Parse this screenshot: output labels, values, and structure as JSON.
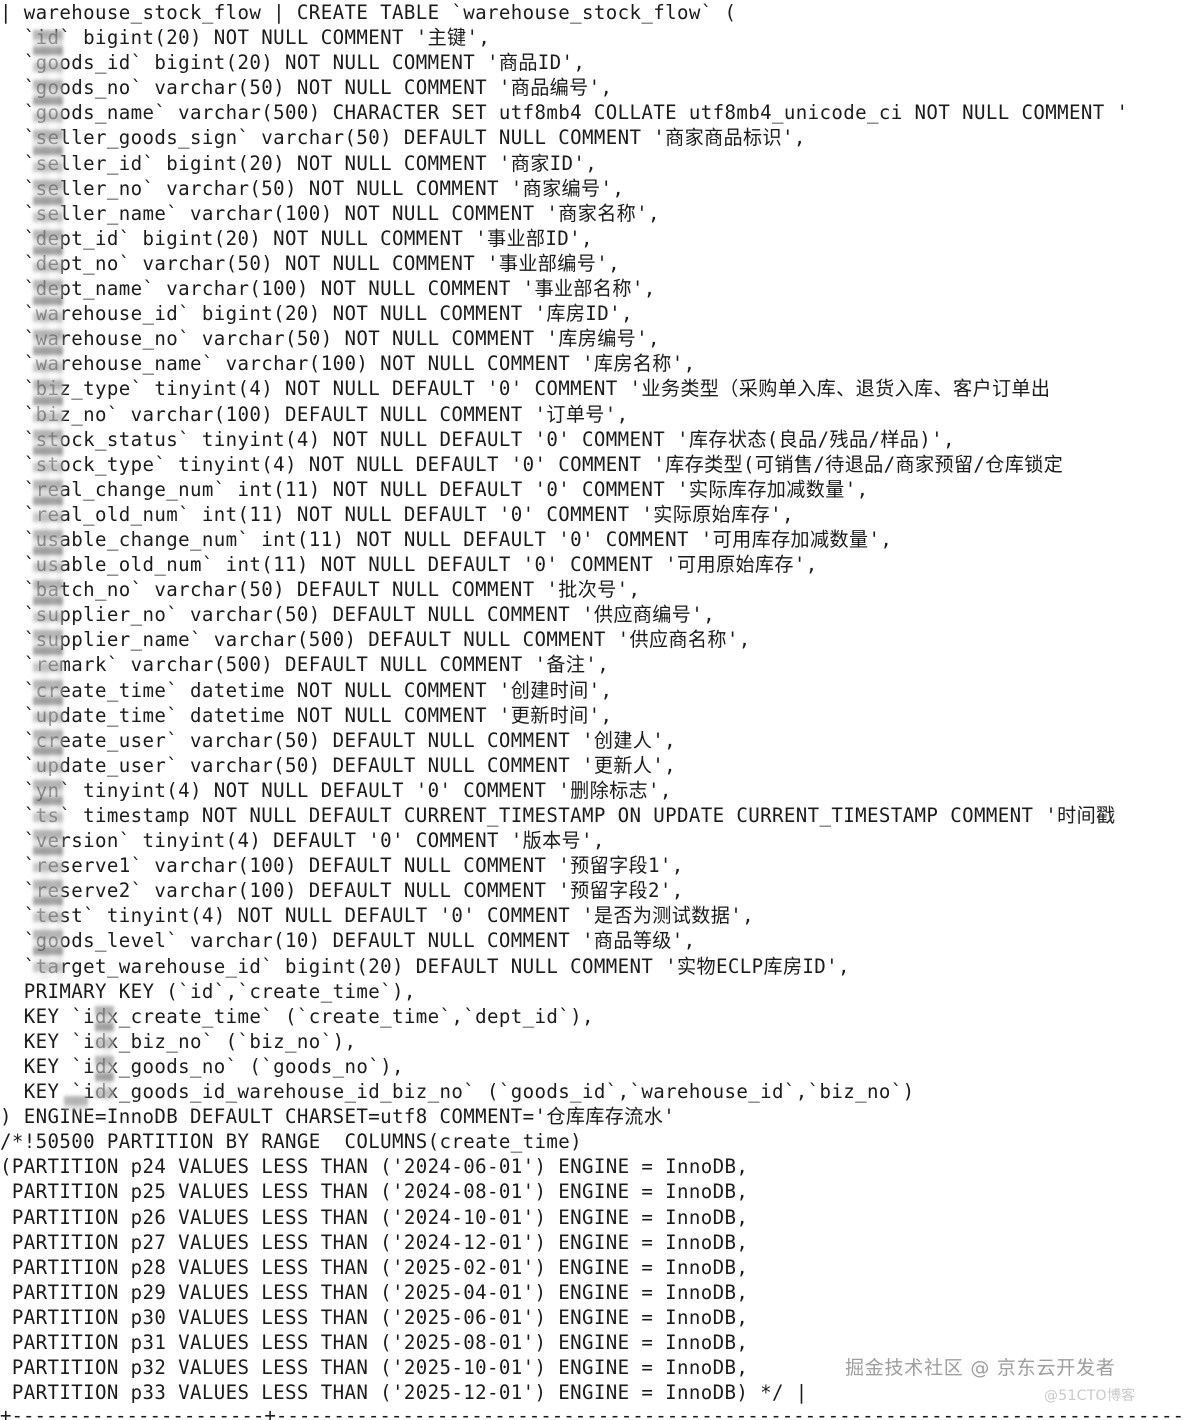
{
  "terminal": {
    "app": "mysql-cli",
    "prompt_symbol": "|",
    "colors": {
      "background": "#ffffff",
      "text": "#1b1b1b",
      "watermark_primary": "#9e9e9e",
      "watermark_secondary": "#c9c9c9"
    }
  },
  "result": {
    "table_name": "warehouse_stock_flow",
    "statement_header": "| warehouse_stock_flow | CREATE TABLE `warehouse_stock_flow` (",
    "bottom_border": "+----------------------+------------------------------------------------------------------------------------------"
  },
  "ddl": {
    "lines": [
      "| warehouse_stock_flow | CREATE TABLE `warehouse_stock_flow` (",
      "  `id` bigint(20) NOT NULL COMMENT '主键',",
      "  `goods_id` bigint(20) NOT NULL COMMENT '商品ID',",
      "  `goods_no` varchar(50) NOT NULL COMMENT '商品编号',",
      "  `goods_name` varchar(500) CHARACTER SET utf8mb4 COLLATE utf8mb4_unicode_ci NOT NULL COMMENT '",
      "  `seller_goods_sign` varchar(50) DEFAULT NULL COMMENT '商家商品标识',",
      "  `seller_id` bigint(20) NOT NULL COMMENT '商家ID',",
      "  `seller_no` varchar(50) NOT NULL COMMENT '商家编号',",
      "  `seller_name` varchar(100) NOT NULL COMMENT '商家名称',",
      "  `dept_id` bigint(20) NOT NULL COMMENT '事业部ID',",
      "  `dept_no` varchar(50) NOT NULL COMMENT '事业部编号',",
      "  `dept_name` varchar(100) NOT NULL COMMENT '事业部名称',",
      "  `warehouse_id` bigint(20) NOT NULL COMMENT '库房ID',",
      "  `warehouse_no` varchar(50) NOT NULL COMMENT '库房编号',",
      "  `warehouse_name` varchar(100) NOT NULL COMMENT '库房名称',",
      "  `biz_type` tinyint(4) NOT NULL DEFAULT '0' COMMENT '业务类型（采购单入库、退货入库、客户订单出",
      "  `biz_no` varchar(100) DEFAULT NULL COMMENT '订单号',",
      "  `stock_status` tinyint(4) NOT NULL DEFAULT '0' COMMENT '库存状态(良品/残品/样品)',",
      "  `stock_type` tinyint(4) NOT NULL DEFAULT '0' COMMENT '库存类型(可销售/待退品/商家预留/仓库锁定",
      "  `real_change_num` int(11) NOT NULL DEFAULT '0' COMMENT '实际库存加减数量',",
      "  `real_old_num` int(11) NOT NULL DEFAULT '0' COMMENT '实际原始库存',",
      "  `usable_change_num` int(11) NOT NULL DEFAULT '0' COMMENT '可用库存加减数量',",
      "  `usable_old_num` int(11) NOT NULL DEFAULT '0' COMMENT '可用原始库存',",
      "  `batch_no` varchar(50) DEFAULT NULL COMMENT '批次号',",
      "  `supplier_no` varchar(50) DEFAULT NULL COMMENT '供应商编号',",
      "  `supplier_name` varchar(500) DEFAULT NULL COMMENT '供应商名称',",
      "  `remark` varchar(500) DEFAULT NULL COMMENT '备注',",
      "  `create_time` datetime NOT NULL COMMENT '创建时间',",
      "  `update_time` datetime NOT NULL COMMENT '更新时间',",
      "  `create_user` varchar(50) DEFAULT NULL COMMENT '创建人',",
      "  `update_user` varchar(50) DEFAULT NULL COMMENT '更新人',",
      "  `yn` tinyint(4) NOT NULL DEFAULT '0' COMMENT '删除标志',",
      "  `ts` timestamp NOT NULL DEFAULT CURRENT_TIMESTAMP ON UPDATE CURRENT_TIMESTAMP COMMENT '时间戳",
      "  `version` tinyint(4) DEFAULT '0' COMMENT '版本号',",
      "  `reserve1` varchar(100) DEFAULT NULL COMMENT '预留字段1',",
      "  `reserve2` varchar(100) DEFAULT NULL COMMENT '预留字段2',",
      "  `test` tinyint(4) NOT NULL DEFAULT '0' COMMENT '是否为测试数据',",
      "  `goods_level` varchar(10) DEFAULT NULL COMMENT '商品等级',",
      "  `target_warehouse_id` bigint(20) DEFAULT NULL COMMENT '实物ECLP库房ID',",
      "  PRIMARY KEY (`id`,`create_time`),",
      "  KEY `idx_create_time` (`create_time`,`dept_id`),",
      "  KEY `idx_biz_no` (`biz_no`),",
      "  KEY `idx_goods_no` (`goods_no`),",
      "  KEY `idx_goods_id_warehouse_id_biz_no` (`goods_id`,`warehouse_id`,`biz_no`)",
      ") ENGINE=InnoDB DEFAULT CHARSET=utf8 COMMENT='仓库库存流水'",
      "/*!50500 PARTITION BY RANGE  COLUMNS(create_time)",
      "(PARTITION p24 VALUES LESS THAN ('2024-06-01') ENGINE = InnoDB,",
      " PARTITION p25 VALUES LESS THAN ('2024-08-01') ENGINE = InnoDB,",
      " PARTITION p26 VALUES LESS THAN ('2024-10-01') ENGINE = InnoDB,",
      " PARTITION p27 VALUES LESS THAN ('2024-12-01') ENGINE = InnoDB,",
      " PARTITION p28 VALUES LESS THAN ('2025-02-01') ENGINE = InnoDB,",
      " PARTITION p29 VALUES LESS THAN ('2025-04-01') ENGINE = InnoDB,",
      " PARTITION p30 VALUES LESS THAN ('2025-06-01') ENGINE = InnoDB,",
      " PARTITION p31 VALUES LESS THAN ('2025-08-01') ENGINE = InnoDB,",
      " PARTITION p32 VALUES LESS THAN ('2025-10-01') ENGINE = InnoDB,",
      " PARTITION p33 VALUES LESS THAN ('2025-12-01') ENGINE = InnoDB) */ |"
    ]
  },
  "columns": [
    {
      "name": "id",
      "type": "bigint(20)",
      "nullability": "NOT NULL",
      "comment": "主键"
    },
    {
      "name": "goods_id",
      "type": "bigint(20)",
      "nullability": "NOT NULL",
      "comment": "商品ID"
    },
    {
      "name": "goods_no",
      "type": "varchar(50)",
      "nullability": "NOT NULL",
      "comment": "商品编号"
    },
    {
      "name": "goods_name",
      "type": "varchar(500)",
      "charset": "utf8mb4",
      "collate": "utf8mb4_unicode_ci",
      "nullability": "NOT NULL",
      "comment": ""
    },
    {
      "name": "seller_goods_sign",
      "type": "varchar(50)",
      "nullability": "DEFAULT NULL",
      "comment": "商家商品标识"
    },
    {
      "name": "seller_id",
      "type": "bigint(20)",
      "nullability": "NOT NULL",
      "comment": "商家ID"
    },
    {
      "name": "seller_no",
      "type": "varchar(50)",
      "nullability": "NOT NULL",
      "comment": "商家编号"
    },
    {
      "name": "seller_name",
      "type": "varchar(100)",
      "nullability": "NOT NULL",
      "comment": "商家名称"
    },
    {
      "name": "dept_id",
      "type": "bigint(20)",
      "nullability": "NOT NULL",
      "comment": "事业部ID"
    },
    {
      "name": "dept_no",
      "type": "varchar(50)",
      "nullability": "NOT NULL",
      "comment": "事业部编号"
    },
    {
      "name": "dept_name",
      "type": "varchar(100)",
      "nullability": "NOT NULL",
      "comment": "事业部名称"
    },
    {
      "name": "warehouse_id",
      "type": "bigint(20)",
      "nullability": "NOT NULL",
      "comment": "库房ID"
    },
    {
      "name": "warehouse_no",
      "type": "varchar(50)",
      "nullability": "NOT NULL",
      "comment": "库房编号"
    },
    {
      "name": "warehouse_name",
      "type": "varchar(100)",
      "nullability": "NOT NULL",
      "comment": "库房名称"
    },
    {
      "name": "biz_type",
      "type": "tinyint(4)",
      "nullability": "NOT NULL",
      "default": "0",
      "comment": "业务类型（采购单入库、退货入库、客户订单出"
    },
    {
      "name": "biz_no",
      "type": "varchar(100)",
      "nullability": "DEFAULT NULL",
      "comment": "订单号"
    },
    {
      "name": "stock_status",
      "type": "tinyint(4)",
      "nullability": "NOT NULL",
      "default": "0",
      "comment": "库存状态(良品/残品/样品)"
    },
    {
      "name": "stock_type",
      "type": "tinyint(4)",
      "nullability": "NOT NULL",
      "default": "0",
      "comment": "库存类型(可销售/待退品/商家预留/仓库锁定"
    },
    {
      "name": "real_change_num",
      "type": "int(11)",
      "nullability": "NOT NULL",
      "default": "0",
      "comment": "实际库存加减数量"
    },
    {
      "name": "real_old_num",
      "type": "int(11)",
      "nullability": "NOT NULL",
      "default": "0",
      "comment": "实际原始库存"
    },
    {
      "name": "usable_change_num",
      "type": "int(11)",
      "nullability": "NOT NULL",
      "default": "0",
      "comment": "可用库存加减数量"
    },
    {
      "name": "usable_old_num",
      "type": "int(11)",
      "nullability": "NOT NULL",
      "default": "0",
      "comment": "可用原始库存"
    },
    {
      "name": "batch_no",
      "type": "varchar(50)",
      "nullability": "DEFAULT NULL",
      "comment": "批次号"
    },
    {
      "name": "supplier_no",
      "type": "varchar(50)",
      "nullability": "DEFAULT NULL",
      "comment": "供应商编号"
    },
    {
      "name": "supplier_name",
      "type": "varchar(500)",
      "nullability": "DEFAULT NULL",
      "comment": "供应商名称"
    },
    {
      "name": "remark",
      "type": "varchar(500)",
      "nullability": "DEFAULT NULL",
      "comment": "备注"
    },
    {
      "name": "create_time",
      "type": "datetime",
      "nullability": "NOT NULL",
      "comment": "创建时间"
    },
    {
      "name": "update_time",
      "type": "datetime",
      "nullability": "NOT NULL",
      "comment": "更新时间"
    },
    {
      "name": "create_user",
      "type": "varchar(50)",
      "nullability": "DEFAULT NULL",
      "comment": "创建人"
    },
    {
      "name": "update_user",
      "type": "varchar(50)",
      "nullability": "DEFAULT NULL",
      "comment": "更新人"
    },
    {
      "name": "yn",
      "type": "tinyint(4)",
      "nullability": "NOT NULL",
      "default": "0",
      "comment": "删除标志"
    },
    {
      "name": "ts",
      "type": "timestamp",
      "nullability": "NOT NULL",
      "default": "CURRENT_TIMESTAMP",
      "on_update": "CURRENT_TIMESTAMP",
      "comment": "时间戳"
    },
    {
      "name": "version",
      "type": "tinyint(4)",
      "default": "0",
      "comment": "版本号"
    },
    {
      "name": "reserve1",
      "type": "varchar(100)",
      "nullability": "DEFAULT NULL",
      "comment": "预留字段1"
    },
    {
      "name": "reserve2",
      "type": "varchar(100)",
      "nullability": "DEFAULT NULL",
      "comment": "预留字段2"
    },
    {
      "name": "test",
      "type": "tinyint(4)",
      "nullability": "NOT NULL",
      "default": "0",
      "comment": "是否为测试数据"
    },
    {
      "name": "goods_level",
      "type": "varchar(10)",
      "nullability": "DEFAULT NULL",
      "comment": "商品等级"
    },
    {
      "name": "target_warehouse_id",
      "type": "bigint(20)",
      "nullability": "DEFAULT NULL",
      "comment": "实物ECLP库房ID"
    }
  ],
  "indexes": [
    {
      "kind": "PRIMARY KEY",
      "name": "",
      "columns": "`id`,`create_time`"
    },
    {
      "kind": "KEY",
      "name": "idx_create_time",
      "columns": "`create_time`,`dept_id`"
    },
    {
      "kind": "KEY",
      "name": "idx_biz_no",
      "columns": "`biz_no`"
    },
    {
      "kind": "KEY",
      "name": "idx_goods_no",
      "columns": "`goods_no`"
    },
    {
      "kind": "KEY",
      "name": "idx_goods_id_warehouse_id_biz_no",
      "columns": "`goods_id`,`warehouse_id`,`biz_no`"
    }
  ],
  "table_options": {
    "engine": "InnoDB",
    "default_charset": "utf8",
    "comment": "仓库库存流水",
    "partition_clause": "/*!50500 PARTITION BY RANGE  COLUMNS(create_time)"
  },
  "partitions": [
    {
      "name": "p24",
      "less_than": "2024-06-01",
      "engine": "InnoDB"
    },
    {
      "name": "p25",
      "less_than": "2024-08-01",
      "engine": "InnoDB"
    },
    {
      "name": "p26",
      "less_than": "2024-10-01",
      "engine": "InnoDB"
    },
    {
      "name": "p27",
      "less_than": "2024-12-01",
      "engine": "InnoDB"
    },
    {
      "name": "p28",
      "less_than": "2025-02-01",
      "engine": "InnoDB"
    },
    {
      "name": "p29",
      "less_than": "2025-04-01",
      "engine": "InnoDB"
    },
    {
      "name": "p30",
      "less_than": "2025-06-01",
      "engine": "InnoDB"
    },
    {
      "name": "p31",
      "less_than": "2025-08-01",
      "engine": "InnoDB"
    },
    {
      "name": "p32",
      "less_than": "2025-10-01",
      "engine": "InnoDB"
    },
    {
      "name": "p33",
      "less_than": "2025-12-01",
      "engine": "InnoDB"
    }
  ],
  "watermarks": {
    "primary": "掘金技术社区 @ 京东云开发者",
    "secondary": "@51CTO博客"
  }
}
